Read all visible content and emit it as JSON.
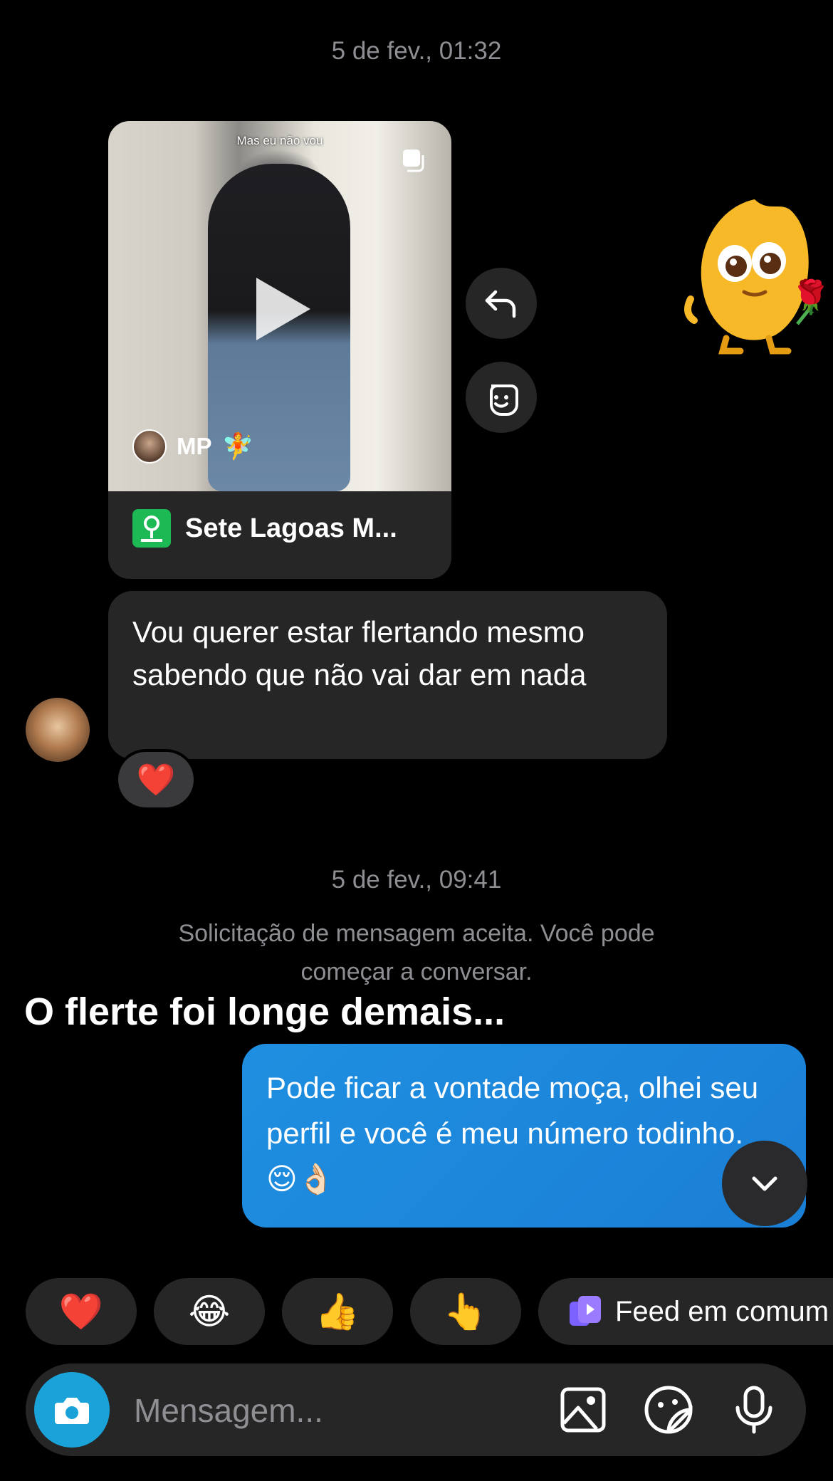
{
  "timestamps": {
    "first": "5 de fev., 01:32",
    "second": "5 de fev., 09:41"
  },
  "post": {
    "caption": "Mas eu não vou",
    "author_name": "MP",
    "author_emoji": "🧚",
    "location_title": "Sete Lagoas M..."
  },
  "sticker_emoji": "🌹",
  "messages": {
    "incoming_text": "Vou querer estar flertando mesmo sabendo que não vai dar em nada",
    "reaction": "❤️",
    "outgoing_text": "Pode ficar a vontade moça, olhei seu perfil e você é meu número todinho. 😌👌🏻"
  },
  "system_notice": "Solicitação de mensagem aceita. Você pode começar a conversar.",
  "overlay_caption": "O flerte foi longe demais...",
  "quick_reactions": [
    "❤️",
    "😂",
    "👍",
    "👆"
  ],
  "feed_chip_label": "Feed em comum",
  "composer": {
    "placeholder": "Mensagem..."
  },
  "colors": {
    "background": "#000000",
    "bubble_incoming": "#262626",
    "bubble_outgoing": "#1a87db",
    "camera_button": "#1aa3d9"
  }
}
